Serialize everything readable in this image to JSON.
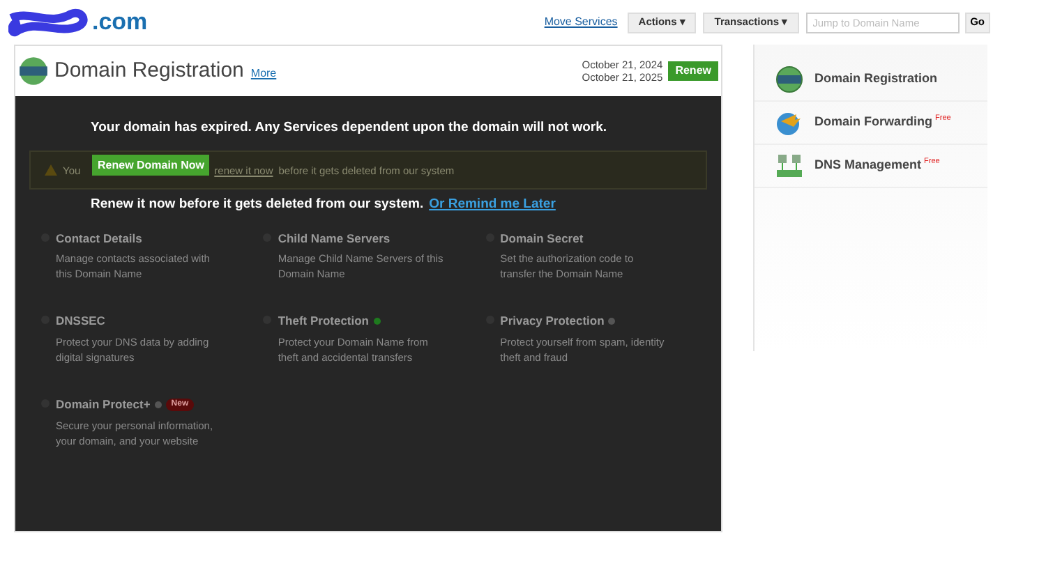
{
  "header": {
    "logo": ".com",
    "links": [
      "Move Services"
    ],
    "menus": [
      {
        "label": "Actions",
        "caret": "▾"
      },
      {
        "label": "Transactions",
        "caret": "▾"
      }
    ],
    "search": {
      "placeholder": "Jump to Domain Name"
    },
    "go": "Go"
  },
  "panel": {
    "title": "Domain Registration",
    "more": "More",
    "dates": [
      "October 21, 2024",
      "October 21, 2025"
    ],
    "renew": "Renew"
  },
  "modal": {
    "message": "Your domain has expired. Any Services dependent upon the domain will not work.",
    "button": "Renew Domain Now",
    "sub": "Renew it now before it gets deleted from our system.",
    "remind": "Or Remind me Later"
  },
  "alert": {
    "start": "You",
    "link": "renew it now",
    "end": "before it gets deleted from our system"
  },
  "services": [
    {
      "title": "Contact Details",
      "description": "Manage contacts associated with this Domain Name"
    },
    {
      "title": "Child Name Servers",
      "description": "Manage Child Name Servers of this Domain Name"
    },
    {
      "title": "Domain Secret",
      "description": "Set the authorization code to transfer the Domain Name"
    },
    {
      "title": "DNSSEC",
      "description": "Protect your DNS data by adding digital signatures"
    },
    {
      "title": "Theft Protection",
      "description": "Protect your Domain Name from theft and accidental transfers",
      "color": "#1e7a1e"
    },
    {
      "title": "Privacy Protection",
      "description": "Protect yourself from spam, identity theft and fraud",
      "color": "#555555"
    },
    {
      "title": "Domain Protect+",
      "description": "Secure your personal information, your domain, and your website",
      "color": "#555555",
      "badge": "New"
    }
  ],
  "sidebar": {
    "items": [
      {
        "kind": "registration",
        "label": "Domain Registration"
      },
      {
        "kind": "forwarding",
        "label": "Domain Forwarding",
        "badge": "Free"
      },
      {
        "kind": "dns",
        "label": "DNS Management",
        "badge": "Free"
      }
    ]
  }
}
